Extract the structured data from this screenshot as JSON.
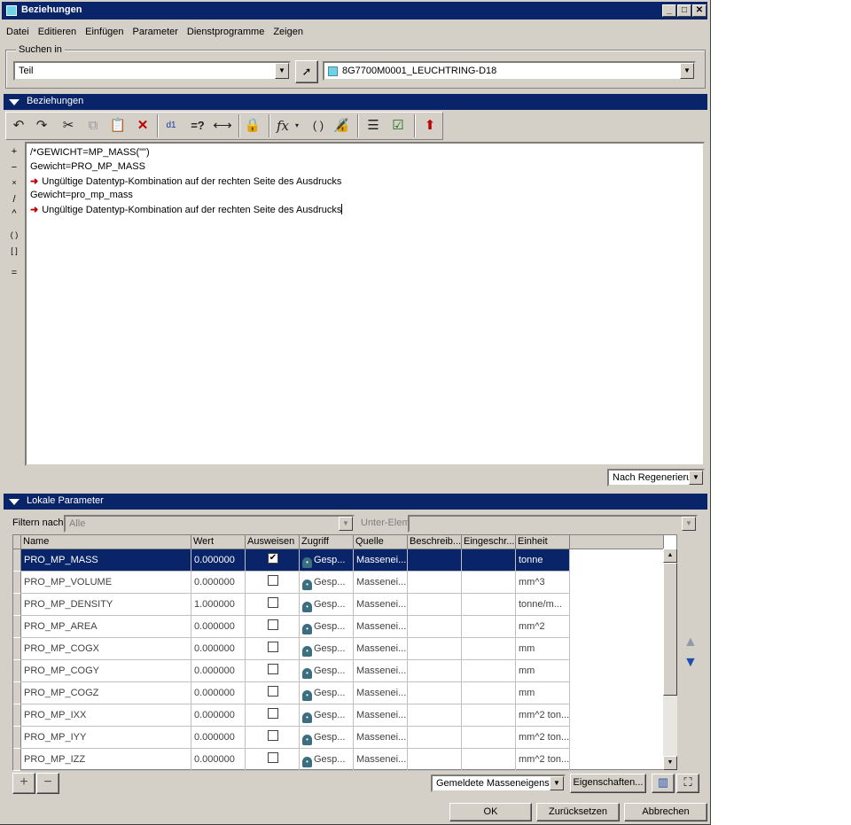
{
  "window": {
    "title": "Beziehungen"
  },
  "menu": [
    "Datei",
    "Editieren",
    "Einfügen",
    "Parameter",
    "Dienstprogramme",
    "Zeigen"
  ],
  "search": {
    "label": "Suchen in",
    "scope_value": "Teil",
    "model_value": "8G7700M0001_LEUCHTRING-D18"
  },
  "relations": {
    "section_title": "Beziehungen",
    "operators": [
      "+",
      "−",
      "×",
      "/",
      "^",
      "( )",
      "[ ]",
      "="
    ],
    "lines": [
      {
        "text": "/*GEWICHT=MP_MASS(\"\")",
        "error": false
      },
      {
        "text": "Gewicht=PRO_MP_MASS",
        "error": false
      },
      {
        "text": "Ungültige Datentyp-Kombination auf der rechten Seite des Ausdrucks",
        "error": true
      },
      {
        "text": "Gewicht=pro_mp_mass",
        "error": false
      },
      {
        "text": "Ungültige Datentyp-Kombination auf der rechten Seite des Ausdrucks",
        "error": true
      }
    ],
    "regen_option": "Nach Regenerierung"
  },
  "params": {
    "section_title": "Lokale Parameter",
    "filter_label": "Filtern nach",
    "filter_value": "Alle",
    "sub_label": "Unter-Elem",
    "sub_value": "",
    "columns": [
      "Name",
      "Wert",
      "Ausweisen",
      "Zugriff",
      "Quelle",
      "Beschreib...",
      "Eingeschr...",
      "Einheit"
    ],
    "rows": [
      {
        "name": "PRO_MP_MASS",
        "value": "0.000000",
        "shown": true,
        "access": "Gesp...",
        "source": "Massenei...",
        "desc": "",
        "restricted": "",
        "unit": "tonne"
      },
      {
        "name": "PRO_MP_VOLUME",
        "value": "0.000000",
        "shown": false,
        "access": "Gesp...",
        "source": "Massenei...",
        "desc": "",
        "restricted": "",
        "unit": "mm^3"
      },
      {
        "name": "PRO_MP_DENSITY",
        "value": "1.000000",
        "shown": false,
        "access": "Gesp...",
        "source": "Massenei...",
        "desc": "",
        "restricted": "",
        "unit": "tonne/m..."
      },
      {
        "name": "PRO_MP_AREA",
        "value": "0.000000",
        "shown": false,
        "access": "Gesp...",
        "source": "Massenei...",
        "desc": "",
        "restricted": "",
        "unit": "mm^2"
      },
      {
        "name": "PRO_MP_COGX",
        "value": "0.000000",
        "shown": false,
        "access": "Gesp...",
        "source": "Massenei...",
        "desc": "",
        "restricted": "",
        "unit": "mm"
      },
      {
        "name": "PRO_MP_COGY",
        "value": "0.000000",
        "shown": false,
        "access": "Gesp...",
        "source": "Massenei...",
        "desc": "",
        "restricted": "",
        "unit": "mm"
      },
      {
        "name": "PRO_MP_COGZ",
        "value": "0.000000",
        "shown": false,
        "access": "Gesp...",
        "source": "Massenei...",
        "desc": "",
        "restricted": "",
        "unit": "mm"
      },
      {
        "name": "PRO_MP_IXX",
        "value": "0.000000",
        "shown": false,
        "access": "Gesp...",
        "source": "Massenei...",
        "desc": "",
        "restricted": "",
        "unit": "mm^2 ton..."
      },
      {
        "name": "PRO_MP_IYY",
        "value": "0.000000",
        "shown": false,
        "access": "Gesp...",
        "source": "Massenei...",
        "desc": "",
        "restricted": "",
        "unit": "mm^2 ton..."
      },
      {
        "name": "PRO_MP_IZZ",
        "value": "0.000000",
        "shown": false,
        "access": "Gesp...",
        "source": "Massenei...",
        "desc": "",
        "restricted": "",
        "unit": "mm^2 ton..."
      }
    ],
    "mass_option": "Gemeldete Masseneigenschaften",
    "properties_label": "Eigenschaften..."
  },
  "footer": {
    "ok": "OK",
    "reset": "Zurücksetzen",
    "cancel": "Abbrechen"
  },
  "colors": {
    "title_blue": "#0a246a",
    "face": "#d4d0c8",
    "error_red": "#c00000"
  }
}
